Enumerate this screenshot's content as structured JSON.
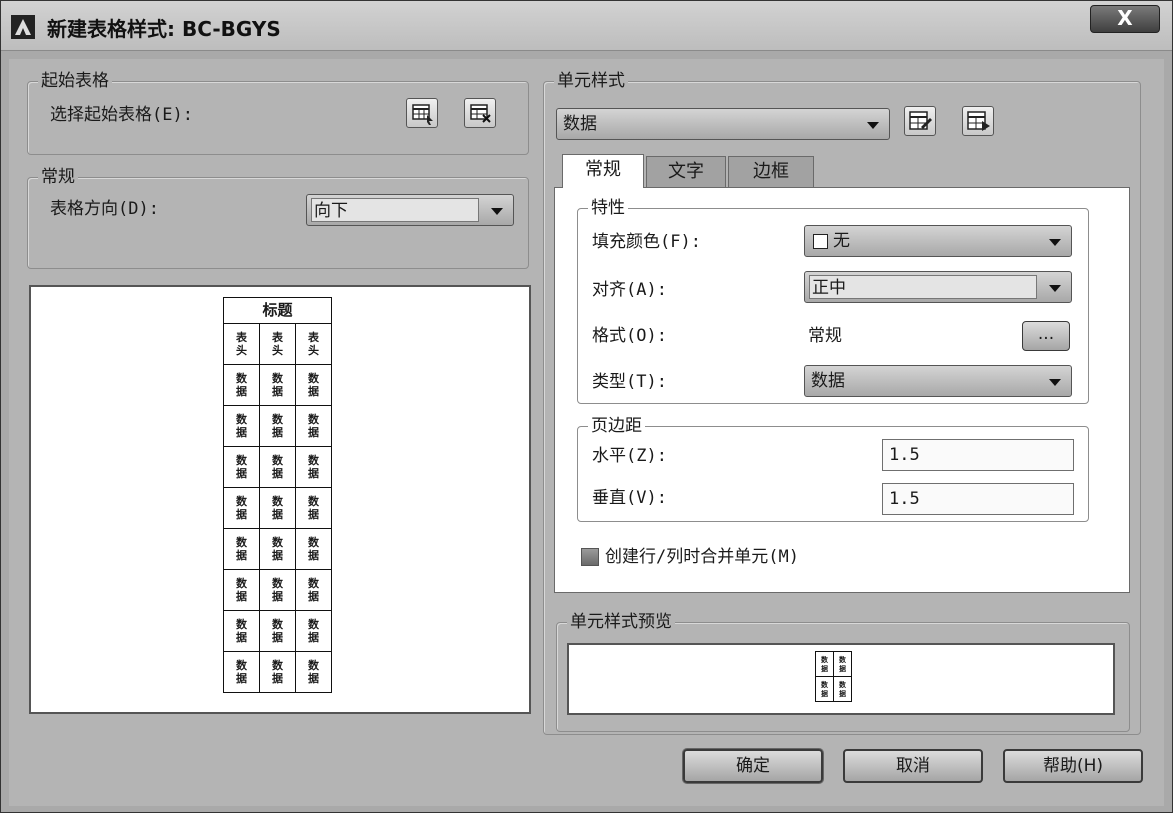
{
  "window": {
    "title": "新建表格样式: BC-BGYS",
    "close_label": "X"
  },
  "start_table": {
    "legend": "起始表格",
    "select_label": "选择起始表格(E):",
    "select_icon": "table-select-icon",
    "remove_icon": "table-remove-icon"
  },
  "general": {
    "legend": "常规",
    "direction_label": "表格方向(D):",
    "direction_value": "向下"
  },
  "table_preview": {
    "title": "标题",
    "header_cell": "表\n头",
    "data_cell": "数\n据",
    "columns": 3,
    "data_rows": 8
  },
  "cell_styles": {
    "legend": "单元样式",
    "style_value": "数据",
    "create_icon": "create-cell-style-icon",
    "manage_icon": "manage-cell-styles-icon"
  },
  "tabs": [
    {
      "label": "常规",
      "active": true
    },
    {
      "label": "文字",
      "active": false
    },
    {
      "label": "边框",
      "active": false
    }
  ],
  "properties": {
    "legend": "特性",
    "fill_label": "填充颜色(F):",
    "fill_value": "无",
    "align_label": "对齐(A):",
    "align_value": "正中",
    "format_label": "格式(O):",
    "format_value": "常规",
    "format_button": "...",
    "type_label": "类型(T):",
    "type_value": "数据"
  },
  "margins": {
    "legend": "页边距",
    "horizontal_label": "水平(Z):",
    "horizontal_value": "1.5",
    "vertical_label": "垂直(V):",
    "vertical_value": "1.5"
  },
  "merge_checkbox": {
    "label": "创建行/列时合并单元(M)",
    "checked": false
  },
  "cell_preview": {
    "legend": "单元样式预览",
    "cell_text": "数\n据"
  },
  "buttons": {
    "ok": "确定",
    "cancel": "取消",
    "help": "帮助(H)"
  }
}
